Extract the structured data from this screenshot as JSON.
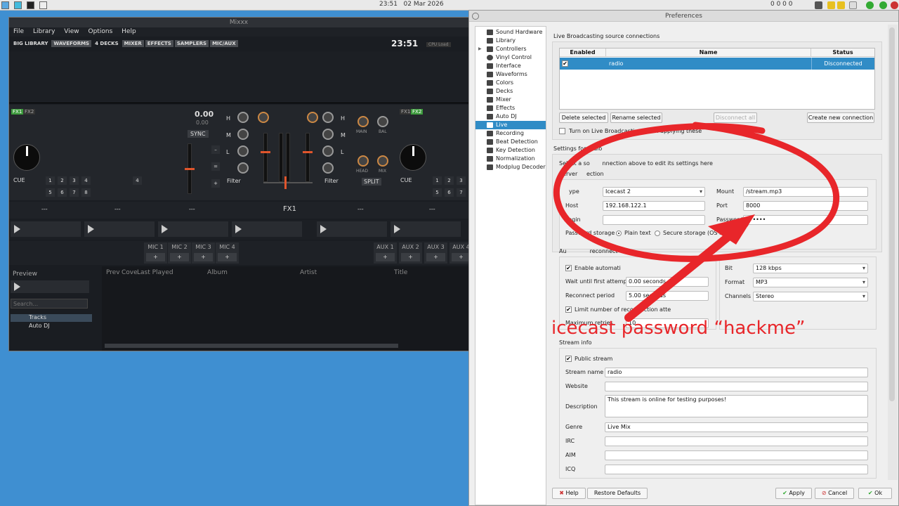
{
  "taskbar": {
    "clock": "23:51",
    "date": "02 Mar 2026",
    "counters": "0 0 0 0"
  },
  "mixxx": {
    "title": "Mixxx",
    "menu": [
      "File",
      "Library",
      "View",
      "Options",
      "Help"
    ],
    "toolbar": [
      "BIG LIBRARY",
      "WAVEFORMS",
      "4 DECKS",
      "MIXER",
      "EFFECTS",
      "SAMPLERS",
      "MIC/AUX"
    ],
    "clock": "23:51",
    "cpu": "CPU Load",
    "fx": {
      "fx1": "FX1",
      "fx2": "FX2"
    },
    "tempo": {
      "value": "0.00",
      "sub": "0.00",
      "sync": "SYNC"
    },
    "eq": {
      "h": "H",
      "m": "M",
      "l": "L"
    },
    "mixer": {
      "main": "MAIN",
      "bal": "BAL",
      "head": "HEAD",
      "mix": "MIX",
      "split": "SPLIT",
      "filter": "Filter"
    },
    "deck": {
      "cue": "CUE",
      "hotcues_top": [
        "1",
        "2",
        "3",
        "4"
      ],
      "hotcues_bot": [
        "5",
        "6",
        "7",
        "8"
      ],
      "loop": "4"
    },
    "fxrow": {
      "select": "---",
      "fx1": "FX1"
    },
    "mics": [
      "MIC 1",
      "MIC 2",
      "MIC 3",
      "MIC 4"
    ],
    "auxes": [
      "AUX 1",
      "AUX 2",
      "AUX 3",
      "AUX 4"
    ],
    "library": {
      "preview": "Preview",
      "search_placeholder": "Search...",
      "tree": [
        "Tracks",
        "Auto DJ"
      ],
      "columns": [
        "Prev",
        "Cove",
        "Last Played",
        "Album",
        "Artist",
        "Title"
      ]
    }
  },
  "prefs": {
    "title": "Preferences",
    "nav": [
      "Sound Hardware",
      "Library",
      "Controllers",
      "Vinyl Control",
      "Interface",
      "Waveforms",
      "Colors",
      "Decks",
      "Mixer",
      "Effects",
      "Auto DJ",
      "Live Broadcasting",
      "Recording",
      "Beat Detection",
      "Key Detection",
      "Normalization",
      "Modplug Decoder"
    ],
    "selected_nav": "Live Broadcasting",
    "connections": {
      "title": "Live Broadcasting source connections",
      "headers": [
        "Enabled",
        "Name",
        "Status"
      ],
      "rows": [
        {
          "enabled": true,
          "name": "radio",
          "status": "Disconnected"
        }
      ],
      "buttons": {
        "delete": "Delete selected",
        "rename": "Rename selected",
        "disconnect": "Disconnect all",
        "create": "Create new connection"
      },
      "turn_on": "Turn on Live Broadcasting when applying these"
    },
    "settings": {
      "title": "Settings for radio",
      "hint": "Select a so",
      "hint2": "nnection above to edit its settings here",
      "server_title": "Server",
      "server_title2": "ection",
      "type_label": "ype",
      "type": "Icecast 2",
      "host_label": "Host",
      "host": "192.168.122.1",
      "login_label": "Login",
      "login": "",
      "mount_label": "Mount",
      "mount": "/stream.mp3",
      "port_label": "Port",
      "port": "8000",
      "password_label": "Password",
      "password": "••••••",
      "pw_storage_label": "Password storage",
      "plain": "Plain text",
      "secure": "Secure storage (OS keych"
    },
    "reconnect": {
      "title": "Au",
      "title2": "reconnect",
      "enable": "Enable automati",
      "wait_label": "Wait until first attempt",
      "wait": "0.00 seconds",
      "period_label": "Reconnect period",
      "period": "5.00 seconds",
      "limit": "Limit number of reconnection atte",
      "max_label": "Maximum retries",
      "max": "10"
    },
    "encoding": {
      "bitrate_label": "Bit",
      "bitrate": "128 kbps",
      "format_label": "Format",
      "format": "MP3",
      "channels_label": "Channels",
      "channels": "Stereo"
    },
    "stream": {
      "title": "Stream info",
      "public": "Public stream",
      "name_label": "Stream name",
      "name": "radio",
      "website_label": "Website",
      "website": "",
      "desc_label": "Description",
      "desc": "This stream is online for testing purposes!",
      "genre_label": "Genre",
      "genre": "Live Mix",
      "irc_label": "IRC",
      "aim_label": "AIM",
      "icq_label": "ICQ"
    },
    "footer": {
      "help": "Help",
      "restore": "Restore Defaults",
      "apply": "Apply",
      "cancel": "Cancel",
      "ok": "Ok"
    }
  },
  "annotation": {
    "text": "icecast  password “hackme”",
    "color": "#e8262a"
  }
}
